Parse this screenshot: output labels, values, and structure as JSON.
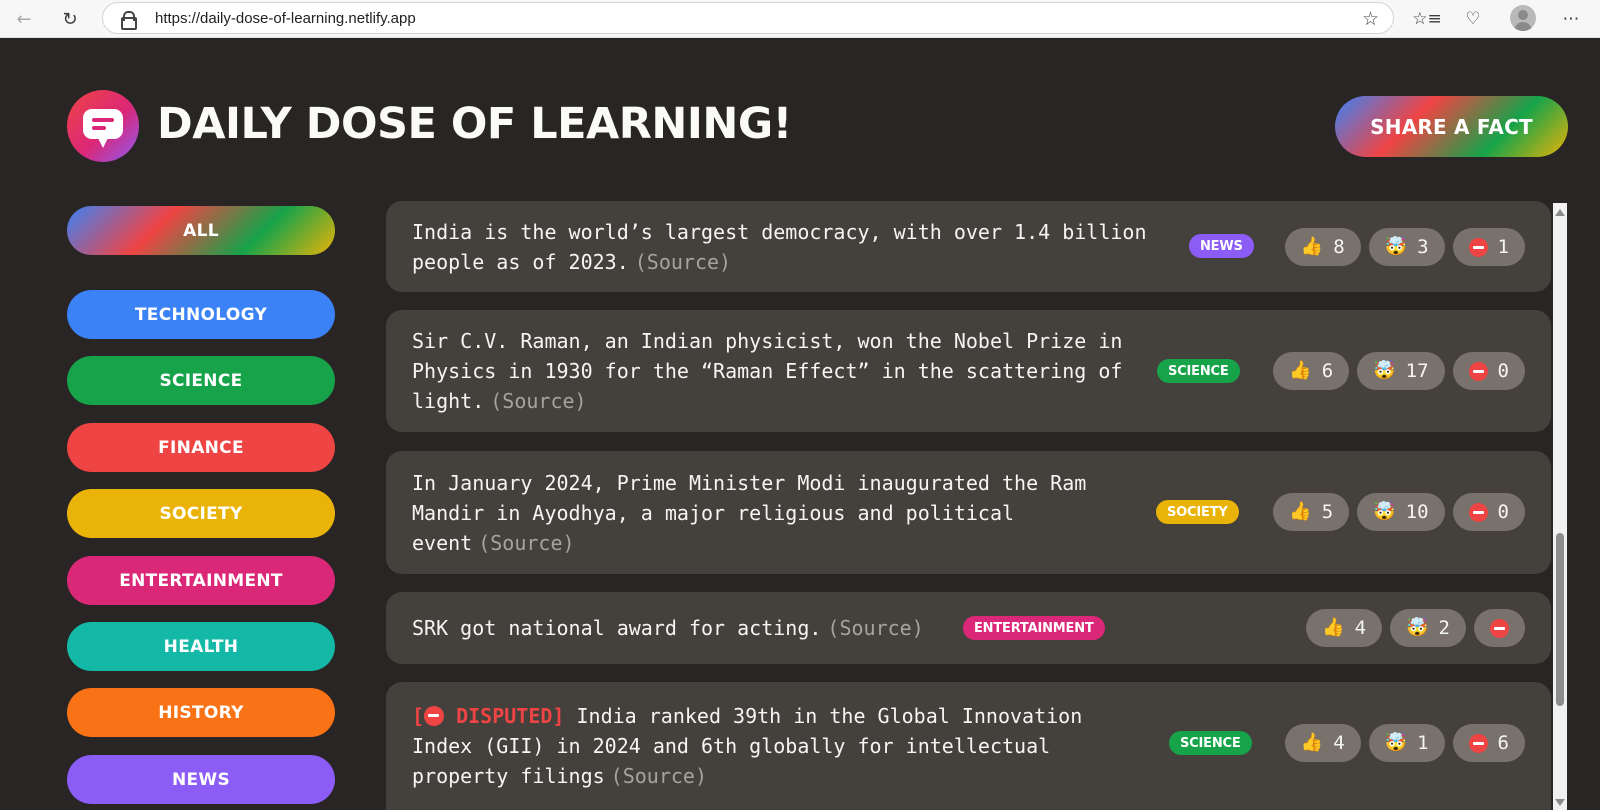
{
  "browser": {
    "url": "https://daily-dose-of-learning.netlify.app",
    "back_icon": "arrow-left",
    "refresh_icon": "refresh",
    "star_icon": "star-outline",
    "favorites_icon": "favorites-list",
    "health_icon": "heart-pulse",
    "more_icon": "ellipsis"
  },
  "header": {
    "title": "Daily Dose Of Learning!",
    "share_label": "Share a fact"
  },
  "categories": [
    {
      "label": "All",
      "color": "gradient"
    },
    {
      "label": "Technology",
      "color": "#3b82f6"
    },
    {
      "label": "Science",
      "color": "#16a34a"
    },
    {
      "label": "Finance",
      "color": "#ef4444"
    },
    {
      "label": "Society",
      "color": "#eab308"
    },
    {
      "label": "Entertainment",
      "color": "#db2777"
    },
    {
      "label": "Health",
      "color": "#14b8a6"
    },
    {
      "label": "History",
      "color": "#f97316"
    },
    {
      "label": "News",
      "color": "#8b5cf6"
    }
  ],
  "facts": [
    {
      "text": "India is the world’s largest democracy, with over 1.4 billion people as of 2023.",
      "source": "(Source)",
      "category": "News",
      "likes": "8",
      "mindblown": "3",
      "false_votes": "1"
    },
    {
      "text": "Sir C.V. Raman, an Indian physicist, won the Nobel Prize in Physics in 1930 for the “Raman Effect” in the scattering of light.",
      "source": "(Source)",
      "category": "Science",
      "likes": "6",
      "mindblown": "17",
      "false_votes": "0"
    },
    {
      "text": "In January 2024, Prime Minister Modi inaugurated the Ram Mandir in Ayodhya, a major religious and political event",
      "source": "(Source)",
      "category": "Society",
      "likes": "5",
      "mindblown": "10",
      "false_votes": "0"
    },
    {
      "text": "SRK got national award for acting.",
      "source": "(Source)",
      "category": "Entertainment",
      "likes": "4",
      "mindblown": "2",
      "false_votes": ""
    },
    {
      "disputed_prefix": "[",
      "disputed_label": "DISPUTED]",
      "text": "India ranked 39th in the Global Innovation Index (GII) in 2024 and 6th globally for intellectual property filings",
      "source": "(Source)",
      "category": "Science",
      "likes": "4",
      "mindblown": "1",
      "false_votes": "6"
    }
  ],
  "emojis": {
    "like": "👍",
    "mindblown": "🤯"
  },
  "colors": {
    "page_bg": "#292524",
    "card_bg": "#44403c",
    "vote_bg": "#78716c",
    "disputed": "#ef4444"
  }
}
